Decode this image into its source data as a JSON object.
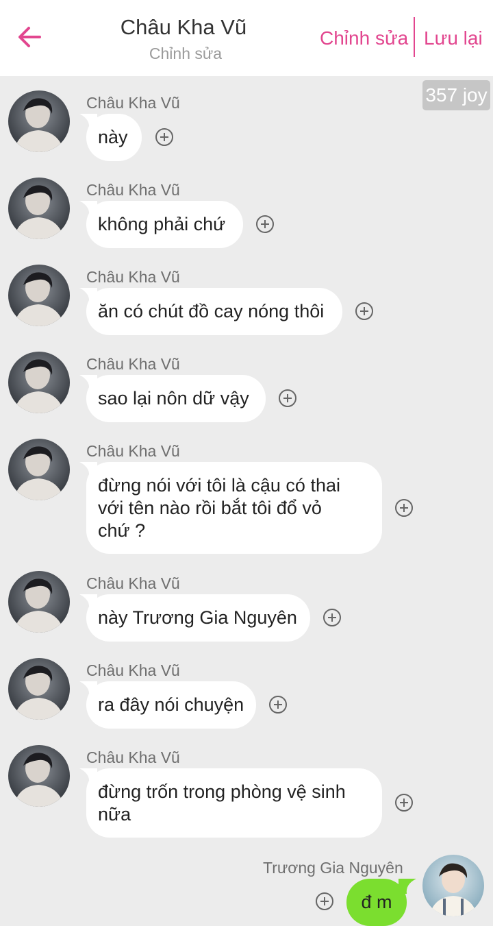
{
  "header": {
    "title": "Châu Kha Vũ",
    "subtitle": "Chỉnh sửa",
    "edit_label": "Chỉnh sửa",
    "save_label": "Lưu lại"
  },
  "badge": {
    "text": "357 joy"
  },
  "messages": [
    {
      "sender": "Châu Kha Vũ",
      "text": "này"
    },
    {
      "sender": "Châu Kha Vũ",
      "text": "không phải chứ"
    },
    {
      "sender": "Châu Kha Vũ",
      "text": "ăn có chút đồ cay nóng thôi"
    },
    {
      "sender": "Châu Kha Vũ",
      "text": "sao lại nôn dữ vậy"
    },
    {
      "sender": "Châu Kha Vũ",
      "text": "đừng nói với tôi là cậu có thai\nvới tên nào rồi bắt tôi đổ vỏ\nchứ ?"
    },
    {
      "sender": "Châu Kha Vũ",
      "text": "này Trương Gia Nguyên"
    },
    {
      "sender": "Châu Kha Vũ",
      "text": "ra đây nói chuyện"
    },
    {
      "sender": "Châu Kha Vũ",
      "text": "đừng trốn trong phòng vệ sinh\nnữa"
    },
    {
      "sender": "Trương Gia Nguyên",
      "text": "đ m"
    }
  ],
  "colors": {
    "accent": "#e2468f",
    "sent_bubble": "#7bde2f",
    "background": "#ececec"
  },
  "icons": {
    "back": "arrow-left-icon",
    "add": "plus-circle-icon"
  }
}
